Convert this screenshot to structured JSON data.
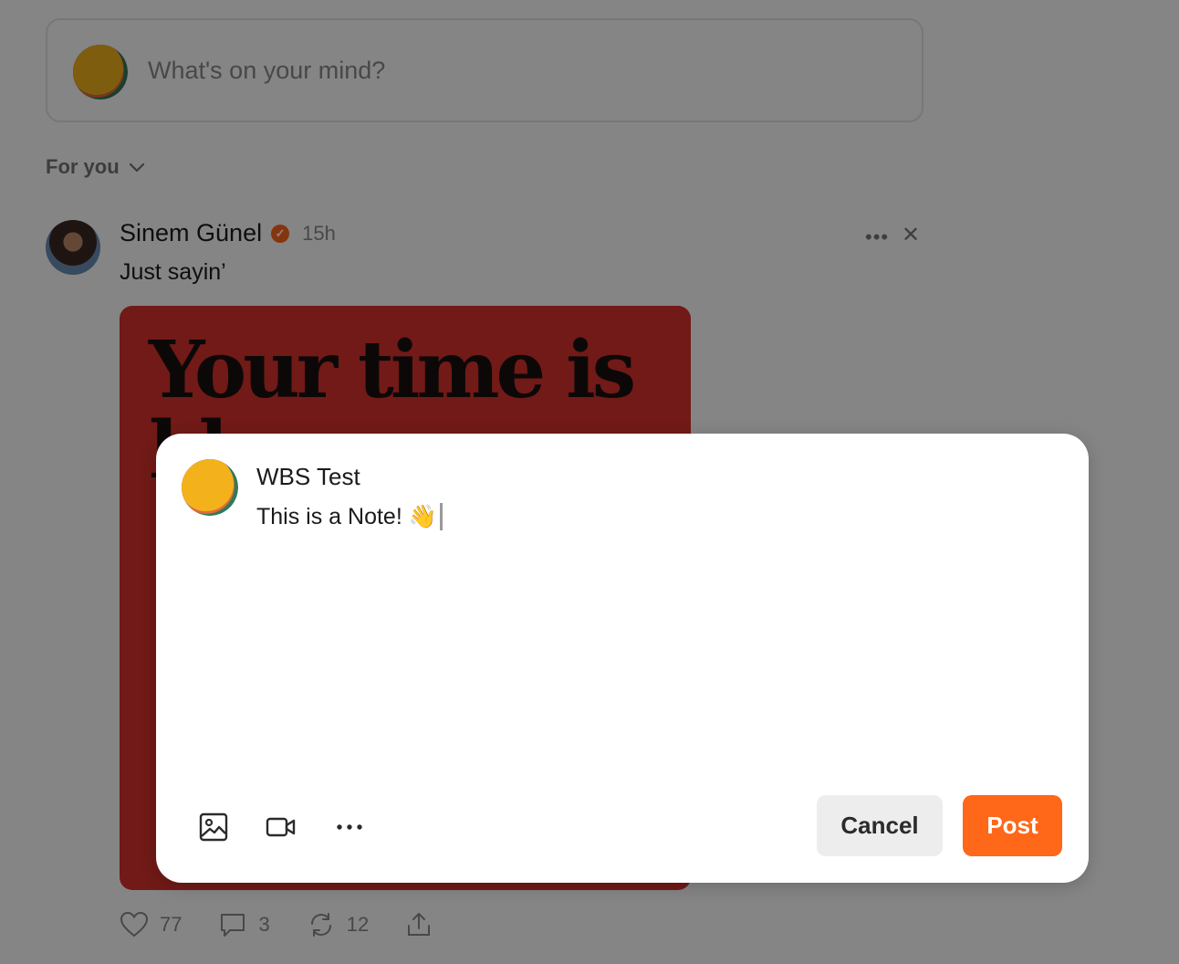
{
  "feed": {
    "composer_placeholder": "What's on your mind?",
    "filter_label": "For you",
    "post": {
      "author": "Sinem Günel",
      "verified_badge": "✓",
      "time": "15h",
      "text": "Just sayin’",
      "image_text_line1": "Your time is",
      "image_text_line2": "l      l",
      "likes": "77",
      "comments": "3",
      "restacks": "12"
    }
  },
  "modal": {
    "author": "WBS Test",
    "note_text": "This is a Note! 👋",
    "cancel_label": "Cancel",
    "post_label": "Post",
    "icons": [
      "image-icon",
      "video-icon",
      "more-icon"
    ]
  },
  "colors": {
    "accent": "#ff6719",
    "overlay": "rgba(0,0,0,0.48)",
    "image_bg": "#d9332d"
  }
}
